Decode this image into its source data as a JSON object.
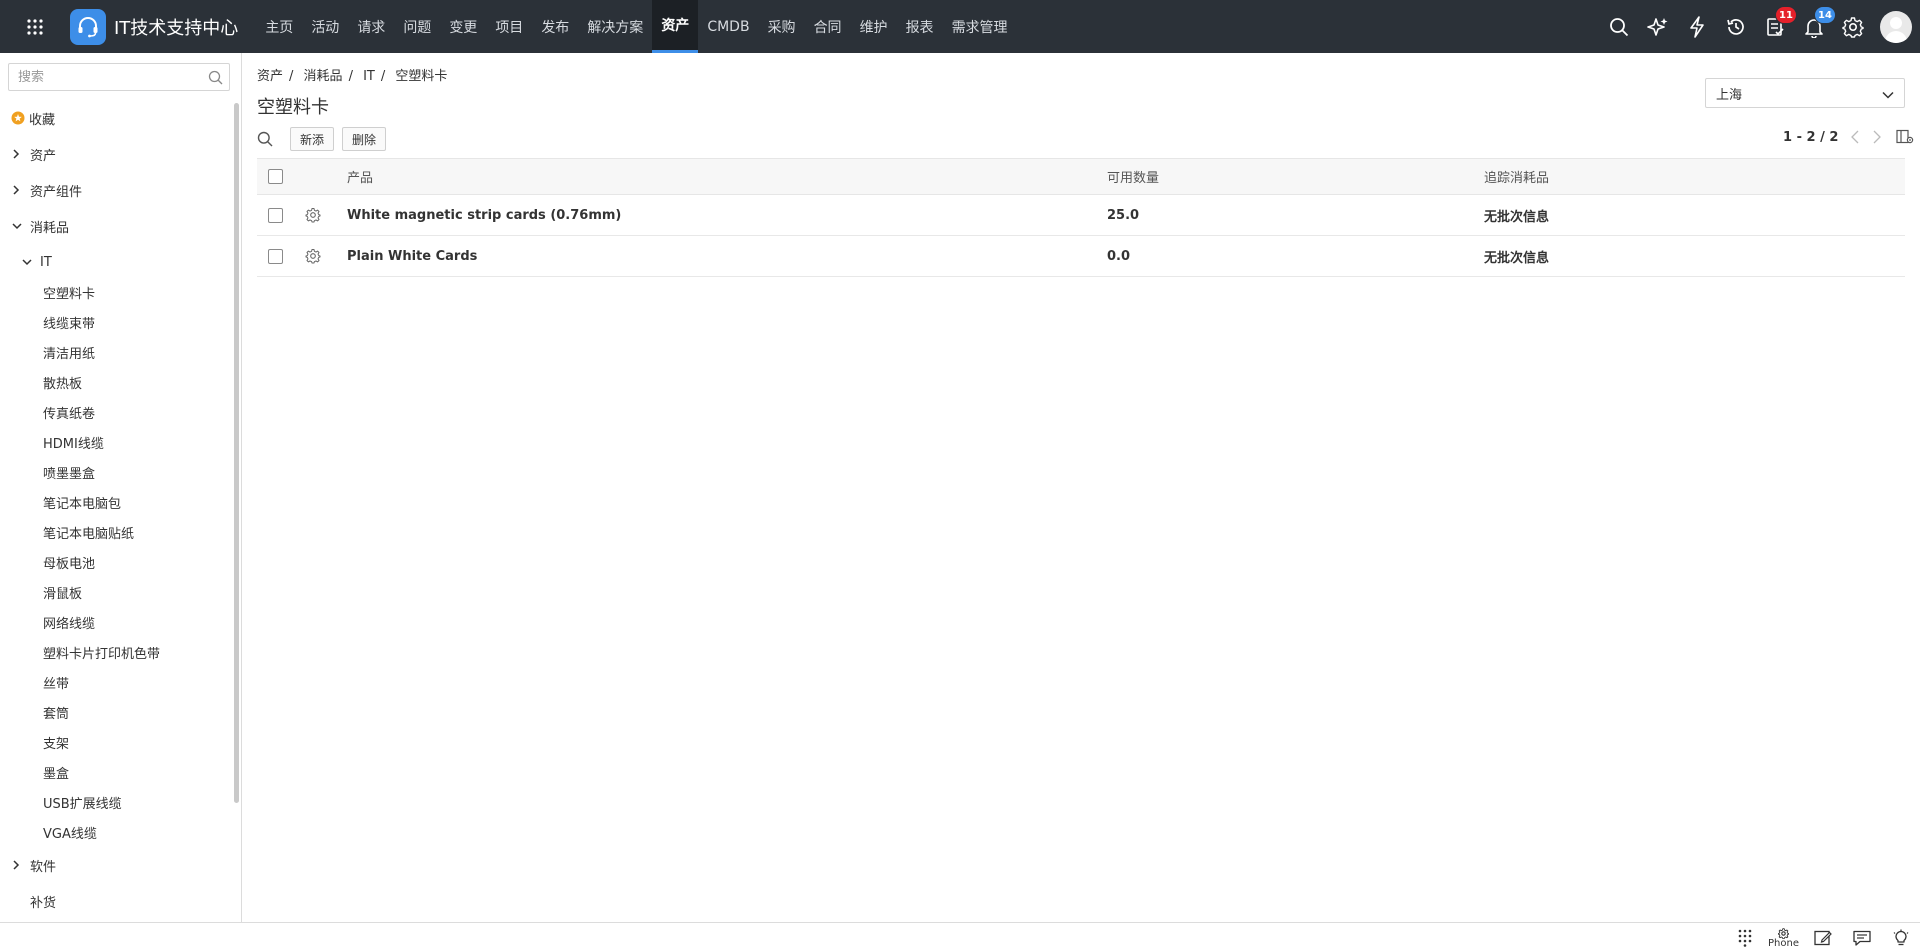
{
  "header": {
    "brand": "IT技术支持中心",
    "nav": [
      "主页",
      "活动",
      "请求",
      "问题",
      "变更",
      "项目",
      "发布",
      "解决方案",
      "资产",
      "CMDB",
      "采购",
      "合同",
      "维护",
      "报表",
      "需求管理"
    ],
    "active_nav": "资产",
    "badges": {
      "tasks": "11",
      "notifications": "14"
    },
    "icons": [
      "search-icon",
      "ai-sparkle-icon",
      "lightning-icon",
      "history-icon",
      "tasks-icon",
      "bell-icon",
      "gear-icon",
      "user-avatar"
    ]
  },
  "sidebar": {
    "search_placeholder": "搜索",
    "favorites": "收藏",
    "assets": "资产",
    "asset_components": "资产组件",
    "consumables": "消耗品",
    "it": "IT",
    "it_items": [
      "空塑料卡",
      "线缆束带",
      "清洁用纸",
      "散热板",
      "传真纸卷",
      "HDMI线缆",
      "喷墨墨盒",
      "笔记本电脑包",
      "笔记本电脑贴纸",
      "母板电池",
      "滑鼠板",
      "网络线缆",
      "塑料卡片打印机色带",
      "丝带",
      "套筒",
      "支架",
      "墨盒",
      "USB扩展线缆",
      "VGA线缆"
    ],
    "software": "软件",
    "replenish": "补货"
  },
  "main": {
    "breadcrumb": [
      "资产",
      "消耗品",
      "IT",
      "空塑料卡"
    ],
    "title": "空塑料卡",
    "location": "上海",
    "buttons": {
      "add": "新添",
      "delete": "删除"
    },
    "pager": "1 - 2 / 2",
    "columns": {
      "product": "产品",
      "quantity": "可用数量",
      "track": "追踪消耗品"
    },
    "rows": [
      {
        "product": "White magnetic strip cards (0.76mm)",
        "quantity": "25.0",
        "track": "无批次信息"
      },
      {
        "product": "Plain White Cards",
        "quantity": "0.0",
        "track": "无批次信息"
      }
    ]
  },
  "footer": {
    "phone": "Phone"
  },
  "colors": {
    "topbar": "#2b3138",
    "accent": "#3d8ee8",
    "badge_red": "#e5202a",
    "favorite_star": "#f0a020"
  }
}
